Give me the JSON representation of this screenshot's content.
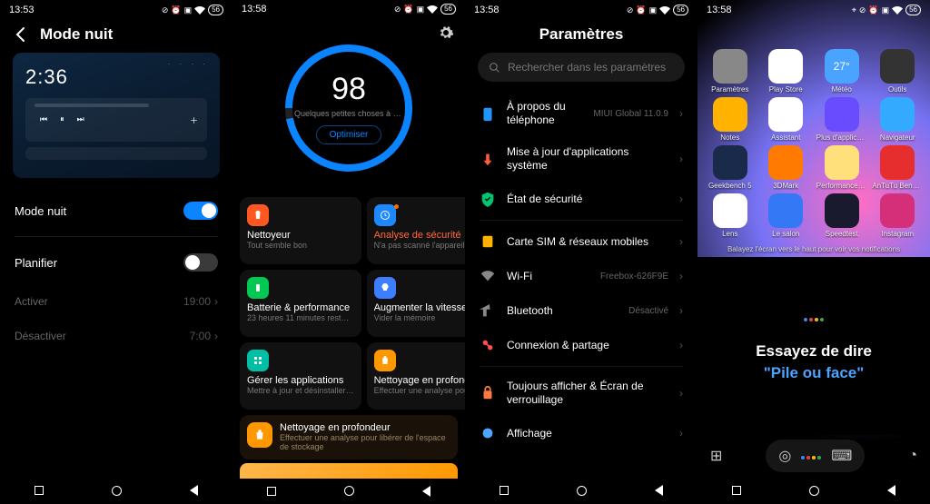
{
  "s1": {
    "time": "13:53",
    "title": "Mode nuit",
    "preview_clock": "2:36",
    "toggle_label": "Mode nuit",
    "schedule_label": "Planifier",
    "activate_label": "Activer",
    "activate_value": "19:00",
    "deactivate_label": "Désactiver",
    "deactivate_value": "7:00"
  },
  "s2": {
    "time": "13:58",
    "score": "98",
    "hint": "Quelques petites choses à opti…",
    "optimize_btn": "Optimiser",
    "cards": [
      {
        "title": "Nettoyeur",
        "subtitle": "Tout semble bon",
        "color": "#ff5722",
        "titleColor": "#fff"
      },
      {
        "title": "Analyse de sécurité",
        "subtitle": "N'a pas scanné l'appareil p…",
        "color": "#1e88ff",
        "titleColor": "#ff6a3c",
        "dot": true
      },
      {
        "title": "Batterie & performance",
        "subtitle": "23 heures 11 minutes  rest…",
        "color": "#00c853",
        "titleColor": "#fff"
      },
      {
        "title": "Augmenter la vitesse",
        "subtitle": "Vider la mémoire",
        "color": "#3d7eff",
        "titleColor": "#fff"
      },
      {
        "title": "Gérer les applications",
        "subtitle": "Mettre à jour et désinstaller…",
        "color": "#00bfa5",
        "titleColor": "#fff"
      },
      {
        "title": "Nettoyage en profond…",
        "subtitle": "Effectuer une analyse pour…",
        "color": "#ff9800",
        "titleColor": "#fff"
      }
    ],
    "deep": {
      "title": "Nettoyage en profondeur",
      "subtitle": "Effectuer une analyse pour libérer de l'espace de stockage"
    }
  },
  "s3": {
    "time": "13:58",
    "title": "Paramètres",
    "search_placeholder": "Rechercher dans les paramètres",
    "rows": [
      {
        "label": "À propos du téléphone",
        "value": "MIUI Global 11.0.9",
        "iconColor": "#2094ff"
      },
      {
        "label": "Mise à jour d'applications système",
        "iconColor": "#ff5e3a"
      },
      {
        "label": "État de sécurité",
        "iconColor": "#00c571"
      },
      {
        "divider": true
      },
      {
        "label": "Carte SIM & réseaux mobiles",
        "iconColor": "#ffb300"
      },
      {
        "label": "Wi-Fi",
        "value": "Freebox-626F9E",
        "iconColor": "#888"
      },
      {
        "label": "Bluetooth",
        "value": "Désactivé",
        "iconColor": "#888"
      },
      {
        "label": "Connexion & partage",
        "iconColor": "#ff4d4d"
      },
      {
        "divider": true
      },
      {
        "label": "Toujours afficher & Écran de verrouillage",
        "iconColor": "#ff7a3c"
      },
      {
        "label": "Affichage",
        "iconColor": "#4da6ff"
      }
    ]
  },
  "s4": {
    "time": "13:58",
    "apps": [
      {
        "label": "Paramètres",
        "bg": "#888"
      },
      {
        "label": "Play Store",
        "bg": "#fff"
      },
      {
        "label": "Météo",
        "bg": "#4aa3ff",
        "temp": "27°"
      },
      {
        "label": "Outils",
        "bg": "#333"
      },
      {
        "label": "Notes",
        "bg": "#ffb300"
      },
      {
        "label": "Assistant",
        "bg": "#fff"
      },
      {
        "label": "Plus d'applications",
        "bg": "#6a4cff"
      },
      {
        "label": "Navigateur",
        "bg": "#34aaff"
      },
      {
        "label": "Geekbench 5",
        "bg": "#1a2a4a"
      },
      {
        "label": "3DMark",
        "bg": "#ff7a00"
      },
      {
        "label": "PerformanceTest M…",
        "bg": "#ffe07a"
      },
      {
        "label": "AnTuTu Benchmark",
        "bg": "#e62e2e"
      },
      {
        "label": "Lens",
        "bg": "#fff"
      },
      {
        "label": "Le salon",
        "bg": "#3478f6"
      },
      {
        "label": "Speedtest",
        "bg": "#1a1a2e"
      },
      {
        "label": "Instagram",
        "bg": "#d62f7a"
      }
    ],
    "notif_hint": "Balayez l'écran vers le haut pour voir vos notifications",
    "assistant_line1": "Essayez de dire",
    "assistant_line2": "\"Pile ou face\""
  }
}
